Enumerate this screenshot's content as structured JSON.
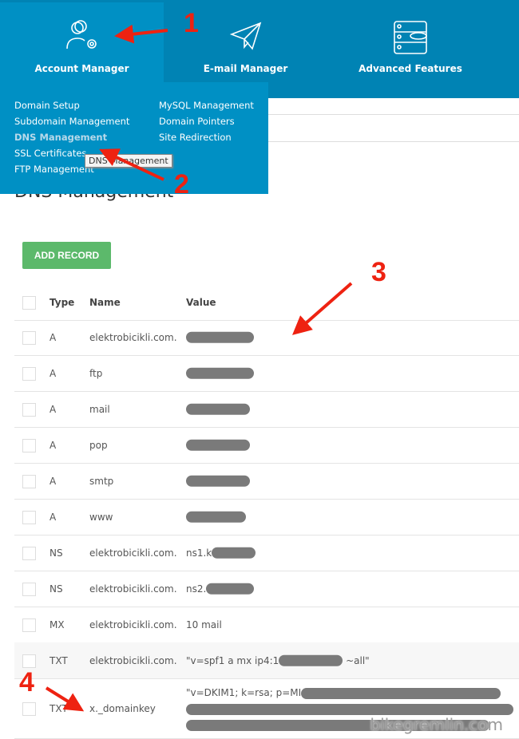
{
  "nav": {
    "tabs": [
      {
        "label": "Account Manager",
        "icon": "users-gear-icon"
      },
      {
        "label": "E-mail Manager",
        "icon": "paper-plane-icon"
      },
      {
        "label": "Advanced Features",
        "icon": "server-database-icon"
      }
    ]
  },
  "dropdown": {
    "col1": [
      "Domain Setup",
      "Subdomain Management",
      "DNS Management",
      "SSL Certificates",
      "FTP Management"
    ],
    "col2": [
      "MySQL Management",
      "Domain Pointers",
      "Site Redirection"
    ],
    "tooltip": "DNS Management"
  },
  "page": {
    "title": "DNS Management",
    "add_button": "ADD RECORD"
  },
  "table": {
    "headers": [
      "Type",
      "Name",
      "Value"
    ],
    "rows": [
      {
        "type": "A",
        "name": "elektrobicikli.com.",
        "value": ""
      },
      {
        "type": "A",
        "name": "ftp",
        "value": ""
      },
      {
        "type": "A",
        "name": "mail",
        "value": ""
      },
      {
        "type": "A",
        "name": "pop",
        "value": ""
      },
      {
        "type": "A",
        "name": "smtp",
        "value": ""
      },
      {
        "type": "A",
        "name": "www",
        "value": ""
      },
      {
        "type": "NS",
        "name": "elektrobicikli.com.",
        "value": "ns1.k"
      },
      {
        "type": "NS",
        "name": "elektrobicikli.com.",
        "value": "ns2."
      },
      {
        "type": "MX",
        "name": "elektrobicikli.com.",
        "value": "10 mail"
      },
      {
        "type": "TXT",
        "name": "elektrobicikli.com.",
        "value": "\"v=spf1 a mx ip4:1",
        "value_end": "~all\""
      },
      {
        "type": "TXT",
        "name": "x._domainkey",
        "value": "\"v=DKIM1; k=rsa; p=MI"
      }
    ]
  },
  "annotations": [
    "1",
    "2",
    "3",
    "4"
  ],
  "watermark": "bikegremlin.com",
  "colors": {
    "nav": "#0083b4",
    "active": "#0090c4",
    "add": "#5cb96b",
    "annotation": "#e21"
  }
}
